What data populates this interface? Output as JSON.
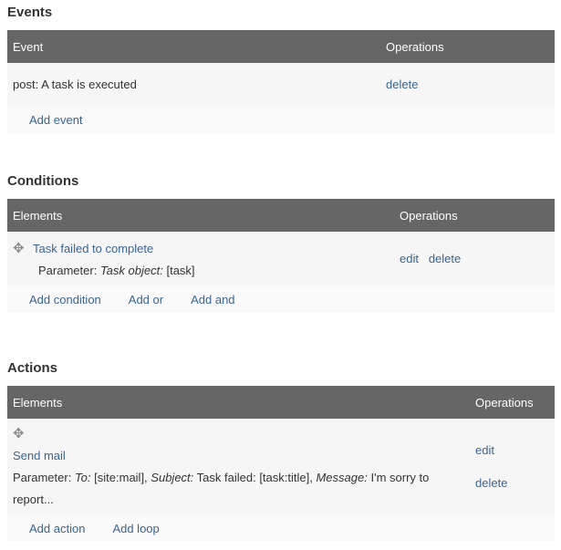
{
  "events": {
    "title": "Events",
    "col_element": "Event",
    "col_ops": "Operations",
    "row": {
      "label": "post: A task is executed",
      "delete": "delete"
    },
    "add": [
      "Add event"
    ]
  },
  "conditions": {
    "title": "Conditions",
    "col_element": "Elements",
    "col_ops": "Operations",
    "row": {
      "name": "Task failed to complete",
      "param_prefix": "Parameter:",
      "param_key": "Task object:",
      "param_val": "[task]",
      "edit": "edit",
      "delete": "delete"
    },
    "add": [
      "Add condition",
      "Add or",
      "Add and"
    ]
  },
  "actions": {
    "title": "Actions",
    "col_element": "Elements",
    "col_ops": "Operations",
    "row": {
      "name": "Send mail",
      "param_prefix": "Parameter:",
      "k1": "To:",
      "v1": "[site:mail],",
      "k2": "Subject:",
      "v2": "Task failed: [task:title],",
      "k3": "Message:",
      "v3": "I'm sorry to report...",
      "edit": "edit",
      "delete": "delete"
    },
    "add": [
      "Add action",
      "Add loop"
    ]
  },
  "icons": {
    "drag": "✥"
  }
}
